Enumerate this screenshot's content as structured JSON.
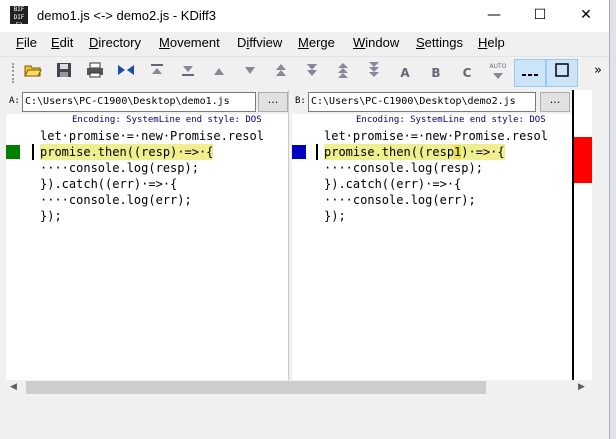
{
  "window": {
    "title": "demo1.js <-> demo2.js - KDiff3",
    "app_icon_text": "KDiff3",
    "minimize_glyph": "—",
    "maximize_glyph": "☐",
    "close_glyph": "✕"
  },
  "menu": [
    {
      "label": "File",
      "u": "F",
      "rest": "ile"
    },
    {
      "label": "Edit",
      "u": "E",
      "rest": "dit"
    },
    {
      "label": "Directory",
      "u": "D",
      "rest": "irectory"
    },
    {
      "label": "Movement",
      "u": "M",
      "rest": "ovement"
    },
    {
      "label": "Diffview",
      "u": "i",
      "pre": "D",
      "rest": "ffview"
    },
    {
      "label": "Merge",
      "u": "M",
      "rest": "erge"
    },
    {
      "label": "Window",
      "u": "W",
      "rest": "indow"
    },
    {
      "label": "Settings",
      "u": "S",
      "rest": "ettings"
    },
    {
      "label": "Help",
      "u": "H",
      "rest": "elp"
    }
  ],
  "toolbar": {
    "buttons": [
      "open-icon",
      "save-icon",
      "print-icon",
      "swap-icon",
      "go-top-icon",
      "go-bottom-icon",
      "prev-delta-icon",
      "next-delta-icon",
      "prev-conflict-icon",
      "next-conflict-icon",
      "prev-unsolved-icon",
      "next-unsolved-icon",
      "choose-a-icon",
      "choose-b-icon",
      "choose-c-icon",
      "auto-solve-icon",
      "show-whitespace-icon",
      "show-line-numbers-icon"
    ],
    "labels": {
      "choose_a": "A",
      "choose_b": "B",
      "choose_c": "C",
      "auto": "AUTO",
      "more": "»"
    }
  },
  "pane_a": {
    "letter": "A:",
    "path": "C:\\Users\\PC-C1900\\Desktop\\demo1.js",
    "browse": "...",
    "info": "Encoding: SystemLine end style: DOS",
    "lines": [
      "let·promise·=·new·Promise.resol",
      "promise.then((resp)·=>·{",
      "····console.log(resp);",
      "}).catch((err)·=>·{",
      "····console.log(err);",
      "});"
    ]
  },
  "pane_b": {
    "letter": "B:",
    "path": "C:\\Users\\PC-C1900\\Desktop\\demo2.js",
    "browse": "...",
    "info": "Encoding: SystemLine end style: DOS",
    "lines": [
      "let·promise·=·new·Promise.resol",
      "promise.then((resp",
      "1",
      ")·=>·{",
      "····console.log(resp);",
      "}).catch((err)·=>·{",
      "····console.log(err);",
      "});"
    ]
  },
  "colors": {
    "pane_a_mark": "#008000",
    "pane_b_mark": "#0000c0",
    "diff_highlight": "#efef8f",
    "overview_diff": "#ff0000"
  }
}
